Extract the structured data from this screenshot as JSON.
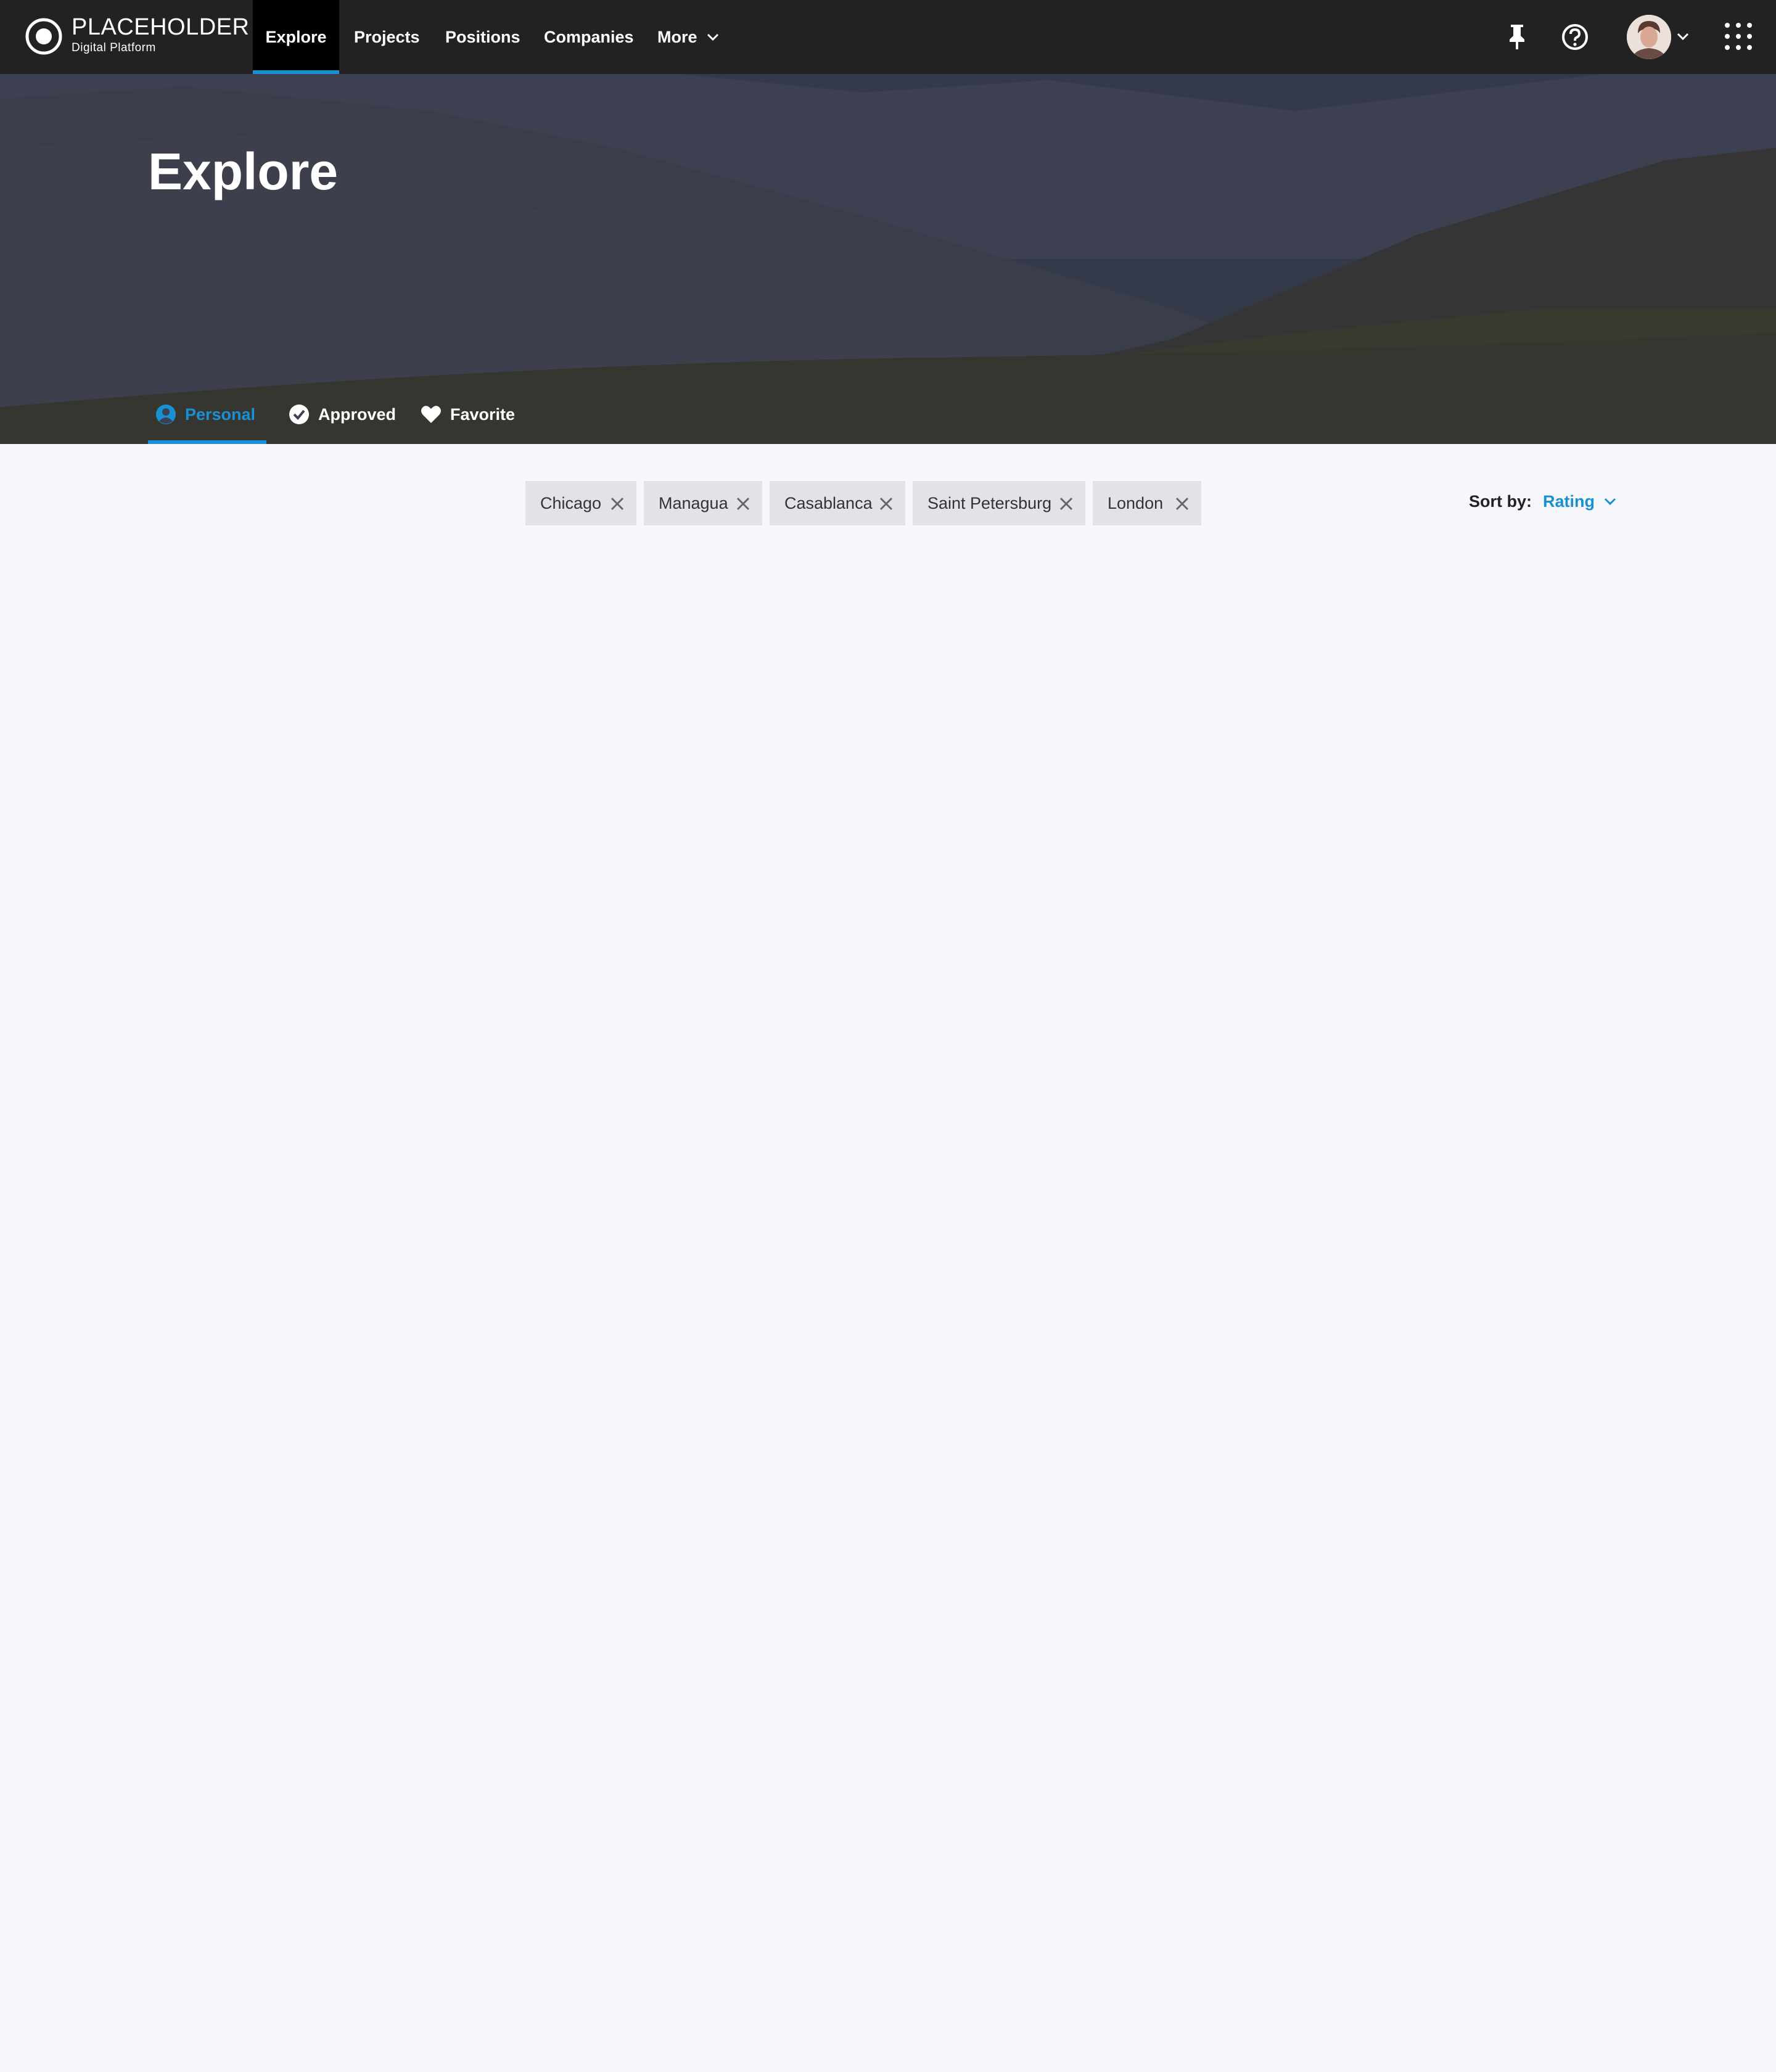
{
  "brand": {
    "name": "PLACEHOLDER",
    "subtitle": "Digital Platform"
  },
  "nav": {
    "items": [
      {
        "label": "Explore",
        "active": true
      },
      {
        "label": "Projects"
      },
      {
        "label": "Positions"
      },
      {
        "label": "Companies"
      },
      {
        "label": "More",
        "icon": "chevron-down-icon"
      }
    ]
  },
  "header_icons": [
    "pin-icon",
    "help-icon",
    "avatar",
    "chevron-down-icon",
    "apps-grid-icon"
  ],
  "hero": {
    "title": "Explore",
    "tabs": [
      {
        "label": "Personal",
        "icon": "user-circle-icon",
        "active": true
      },
      {
        "label": "Approved",
        "icon": "check-circle-icon"
      },
      {
        "label": "Favorite",
        "icon": "heart-icon"
      }
    ]
  },
  "filters": {
    "chips": [
      "Chicago",
      "Managua",
      "Casablanca",
      "Saint Petersburg",
      "London"
    ]
  },
  "sort": {
    "label": "Sort by:",
    "value": "Rating"
  },
  "colors": {
    "accent": "#1a90d4",
    "topbar": "#222222",
    "page_bg": "#f5f7fa",
    "chip_bg": "#e1e3e8"
  }
}
